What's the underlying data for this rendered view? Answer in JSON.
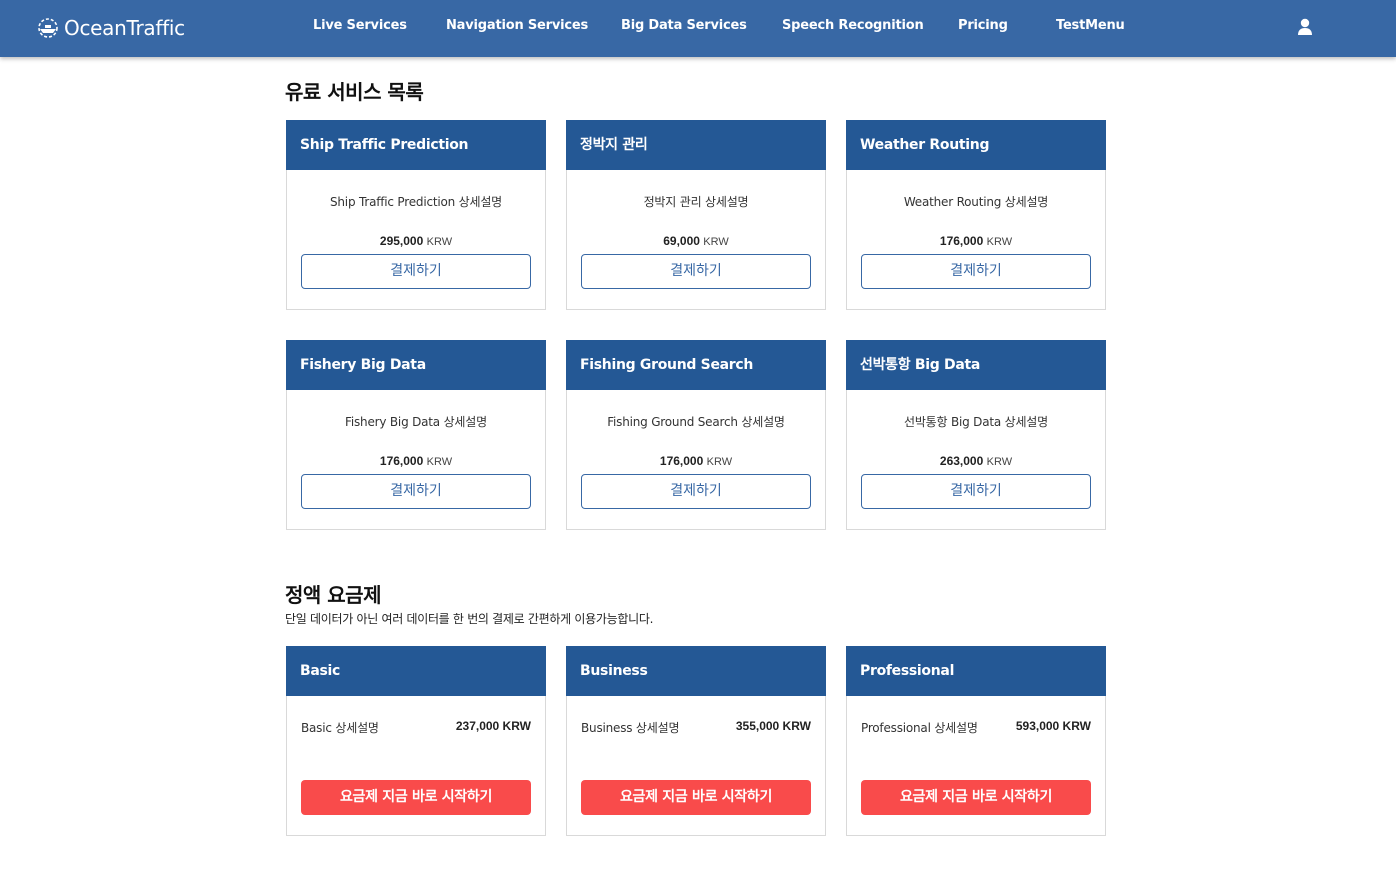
{
  "brand": {
    "name": "OceanTraffic"
  },
  "nav": {
    "items": [
      {
        "label": "Live Services"
      },
      {
        "label": "Navigation Services"
      },
      {
        "label": "Big Data Services"
      },
      {
        "label": "Speech Recognition"
      },
      {
        "label": "Pricing"
      },
      {
        "label": "TestMenu"
      }
    ],
    "user_icon": "user-icon"
  },
  "paid_services": {
    "title": "유료 서비스 목록",
    "pay_label": "결제하기",
    "cards": [
      {
        "name": "Ship Traffic Prediction",
        "desc": "Ship Traffic Prediction 상세설명",
        "price": "295,000",
        "currency": "KRW"
      },
      {
        "name": "정박지 관리",
        "desc": "정박지 관리 상세설명",
        "price": "69,000",
        "currency": "KRW"
      },
      {
        "name": "Weather Routing",
        "desc": "Weather Routing 상세설명",
        "price": "176,000",
        "currency": "KRW"
      },
      {
        "name": "Fishery Big Data",
        "desc": "Fishery Big Data 상세설명",
        "price": "176,000",
        "currency": "KRW"
      },
      {
        "name": "Fishing Ground Search",
        "desc": "Fishing Ground Search 상세설명",
        "price": "176,000",
        "currency": "KRW"
      },
      {
        "name": "선박통항 Big Data",
        "desc": "선박통항 Big Data 상세설명",
        "price": "263,000",
        "currency": "KRW"
      }
    ]
  },
  "plans": {
    "title": "정액 요금제",
    "subtitle": "단일 데이터가 아닌 여러 데이터를 한 번의 결제로 간편하게 이용가능합니다.",
    "start_label": "요금제 지금 바로 시작하기",
    "items": [
      {
        "name": "Basic",
        "desc": "Basic 상세설명",
        "price": "237,000 KRW"
      },
      {
        "name": "Business",
        "desc": "Business 상세설명",
        "price": "355,000 KRW"
      },
      {
        "name": "Professional",
        "desc": "Professional 상세설명",
        "price": "593,000 KRW"
      }
    ]
  },
  "colors": {
    "navbar": "#3868a5",
    "card_header": "#245895",
    "start_button": "#f94b4b"
  }
}
